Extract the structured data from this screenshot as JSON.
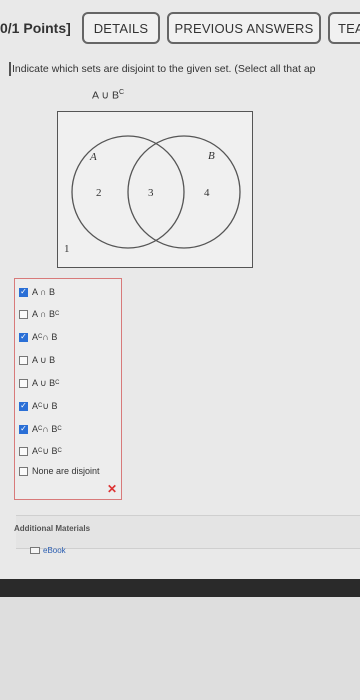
{
  "header": {
    "points": "0/1 Points]",
    "details_label": "DETAILS",
    "previous_answers_label": "PREVIOUS ANSWERS",
    "tea_label": "TEA"
  },
  "question": {
    "prompt": "Indicate which sets are disjoint to the given set. (Select all that ap",
    "given_set_base": "A ∪ B",
    "given_set_sup": "C"
  },
  "venn": {
    "set_a_label": "A",
    "set_b_label": "B",
    "region_1": "1",
    "region_2": "2",
    "region_3": "3",
    "region_4": "4"
  },
  "choices": [
    {
      "text": "A ∩ B",
      "sup": "",
      "suffix": "",
      "checked": true
    },
    {
      "text": "A ∩ B",
      "sup": "C",
      "suffix": "",
      "checked": false
    },
    {
      "text": "A",
      "sup": "C",
      "suffix": " ∩ B",
      "checked": true
    },
    {
      "text": "A ∪ B",
      "sup": "",
      "suffix": "",
      "checked": false
    },
    {
      "text": "A ∪ B",
      "sup": "C",
      "suffix": "",
      "checked": false
    },
    {
      "text": "A",
      "sup": "C",
      "suffix": " ∪ B",
      "checked": true
    },
    {
      "text": "A",
      "sup": "C",
      "suffix": " ∩ B",
      "suffix_sup": "C",
      "checked": true
    },
    {
      "text": "A",
      "sup": "C",
      "suffix": " ∪ B",
      "suffix_sup": "C",
      "checked": false
    },
    {
      "text": "None are disjoint",
      "sup": "",
      "suffix": "",
      "checked": false
    }
  ],
  "feedback": {
    "icon": "x-mark-icon",
    "symbol": "✕",
    "color": "#dd3333"
  },
  "additional": {
    "title": "Additional Materials",
    "ebook_label": "eBook"
  }
}
